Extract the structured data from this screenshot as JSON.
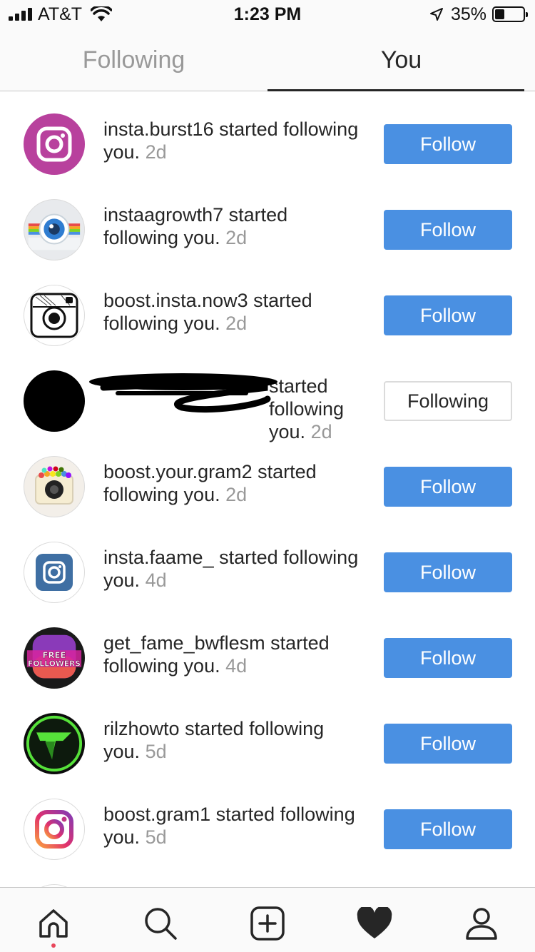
{
  "status_bar": {
    "carrier": "AT&T",
    "time": "1:23 PM",
    "battery_percent": "35%",
    "battery_level": 0.35
  },
  "tabs": {
    "following": "Following",
    "you": "You",
    "active": "You"
  },
  "activity": [
    {
      "username": "insta.burst16",
      "action": "started following you.",
      "age": "2d",
      "button": "Follow",
      "avatar": "instagram-logo-purple"
    },
    {
      "username": "instaagrowth7",
      "action": "started following you.",
      "age": "2d",
      "button": "Follow",
      "avatar": "camera-lens-rainbow"
    },
    {
      "username": "boost.insta.now3",
      "action": "started following you.",
      "age": "2d",
      "button": "Follow",
      "avatar": "sketch-camera"
    },
    {
      "username": "",
      "action": "started following you.",
      "age": "2d",
      "button": "Following",
      "avatar": "black-circle"
    },
    {
      "username": "boost.your.gram2",
      "action": "started following you.",
      "age": "2d",
      "button": "Follow",
      "avatar": "bead-camera"
    },
    {
      "username": "insta.faame_",
      "action": "started following you.",
      "age": "4d",
      "button": "Follow",
      "avatar": "instagram-logo-blue"
    },
    {
      "username": "get_fame_bwflesm",
      "action": "started following you.",
      "age": "4d",
      "button": "Follow",
      "avatar": "free-followers-badge",
      "avatar_text_1": "FREE",
      "avatar_text_2": "FOLLOWERS"
    },
    {
      "username": "rilzhowto",
      "action": "started following you.",
      "age": "5d",
      "button": "Follow",
      "avatar": "green-logo"
    },
    {
      "username": "boost.gram1",
      "action": "started following you.",
      "age": "5d",
      "button": "Follow",
      "avatar": "instagram-logo-gradient"
    }
  ],
  "nav": {
    "items": [
      "home-icon",
      "search-icon",
      "add-post-icon",
      "heart-icon",
      "profile-icon"
    ],
    "active": "heart-icon"
  },
  "colors": {
    "follow_button": "#4a90e2",
    "muted_text": "#999999",
    "notification_dot": "#e8465b"
  }
}
